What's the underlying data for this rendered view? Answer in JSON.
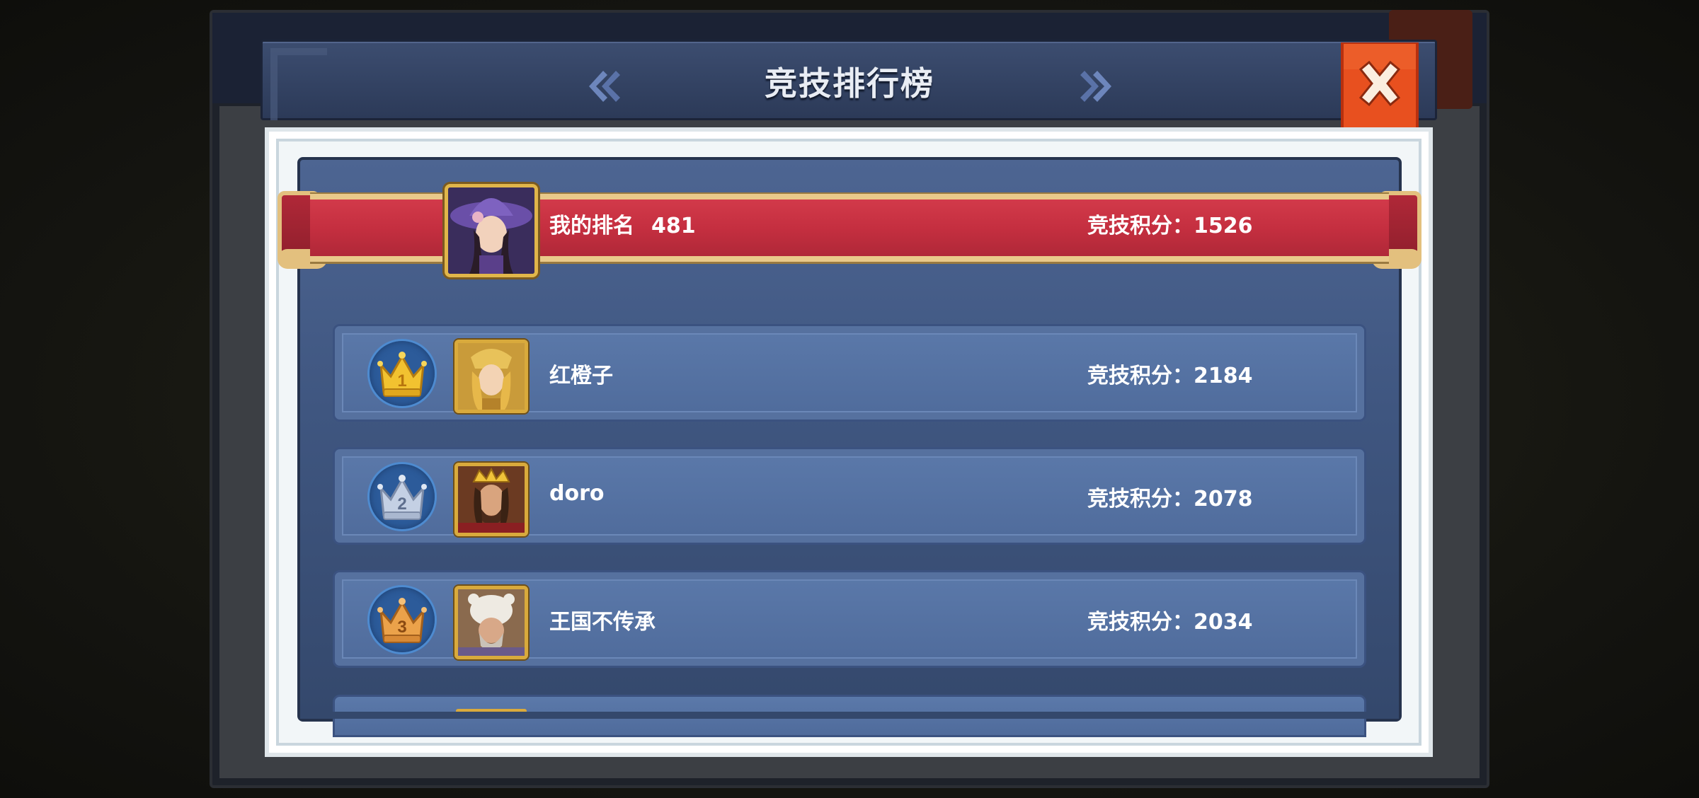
{
  "header": {
    "title": "竞技排行榜",
    "prev_icon": "double-chevron-left-icon",
    "next_icon": "double-chevron-right-icon",
    "close_icon": "close-x-icon"
  },
  "my_rank": {
    "label": "我的排名",
    "rank": "481",
    "score_text": "竞技积分：1526"
  },
  "leaderboard": [
    {
      "rank": "1",
      "name": "红橙子",
      "score_text": "竞技积分：2184"
    },
    {
      "rank": "2",
      "name": "doro",
      "score_text": "竞技积分：2078"
    },
    {
      "rank": "3",
      "name": "王国不传承",
      "score_text": "竞技积分：2034"
    }
  ],
  "colors": {
    "ribbon": "#c52f40",
    "row": "#5572a3",
    "gold": "#e1b64a",
    "close": "#e24a1e"
  }
}
